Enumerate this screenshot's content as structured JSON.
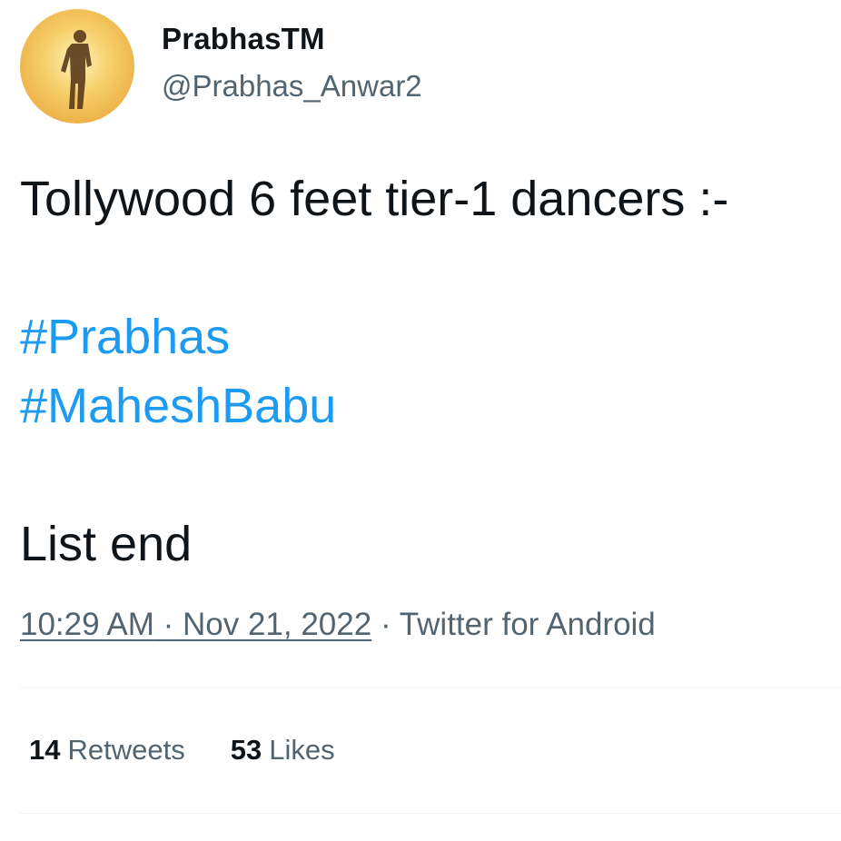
{
  "author": {
    "display_name": "PrabhasTM",
    "handle": "@Prabhas_Anwar2"
  },
  "tweet": {
    "line1": "Tollywood 6 feet tier-1 dancers :-",
    "hashtag1": "#Prabhas",
    "hashtag2": "#MaheshBabu",
    "line_last": "List end"
  },
  "meta": {
    "time": "10:29 AM",
    "separator1": " · ",
    "date": "Nov 21, 2022",
    "separator2": " · ",
    "source": "Twitter for Android"
  },
  "stats": {
    "retweets_count": "14",
    "retweets_label": "Retweets",
    "likes_count": "53",
    "likes_label": "Likes"
  },
  "colors": {
    "hashtag": "#1d9bf0",
    "secondary_text": "#536471",
    "primary_text": "#0f1419"
  }
}
